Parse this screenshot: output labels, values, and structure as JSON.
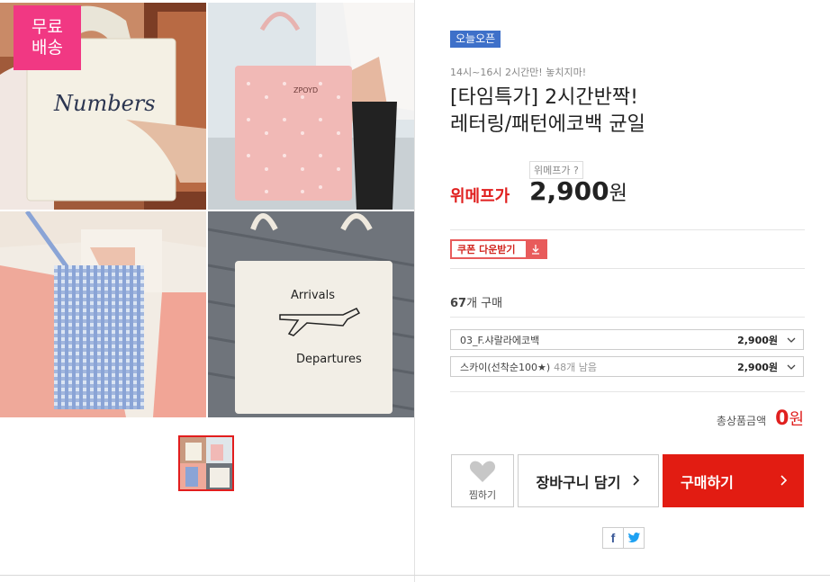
{
  "gallery": {
    "badge_line1": "무료",
    "badge_line2": "배송",
    "photo_texts": {
      "bag1": "Numbers",
      "bag2": "ZPOYD",
      "bag4_top": "Arrivals",
      "bag4_bottom": "Departures"
    }
  },
  "product": {
    "today_badge": "오늘오픈",
    "subcopy": "14시~16시 2시간만! 놓치지마!",
    "title_line1": "[타임특가] 2시간반짝!",
    "title_line2": "레터링/패턴에코백 균일",
    "ref_price_label": "위메프가 ?",
    "price_label": "위메프가",
    "price": "2,900",
    "price_unit": "원",
    "coupon_label": "쿠폰 다운받기",
    "coupon_icon": "download-icon",
    "sold_count": "67",
    "sold_suffix": "개 구매"
  },
  "options": [
    {
      "name": "03_F.샤랄라에코백",
      "stock": "",
      "price": "2,900원"
    },
    {
      "name": "스카이(선착순100★)",
      "stock": "48개 남음",
      "price": "2,900원"
    }
  ],
  "total": {
    "label": "총상품금액",
    "value": "0",
    "unit": "원"
  },
  "actions": {
    "wish_label": "찜하기",
    "cart_label": "장바구니 담기",
    "buy_label": "구매하기"
  },
  "share": {
    "facebook": "f"
  },
  "colors": {
    "accent_red": "#e21c12",
    "badge_pink": "#f13883",
    "today_blue": "#3e70c9"
  }
}
